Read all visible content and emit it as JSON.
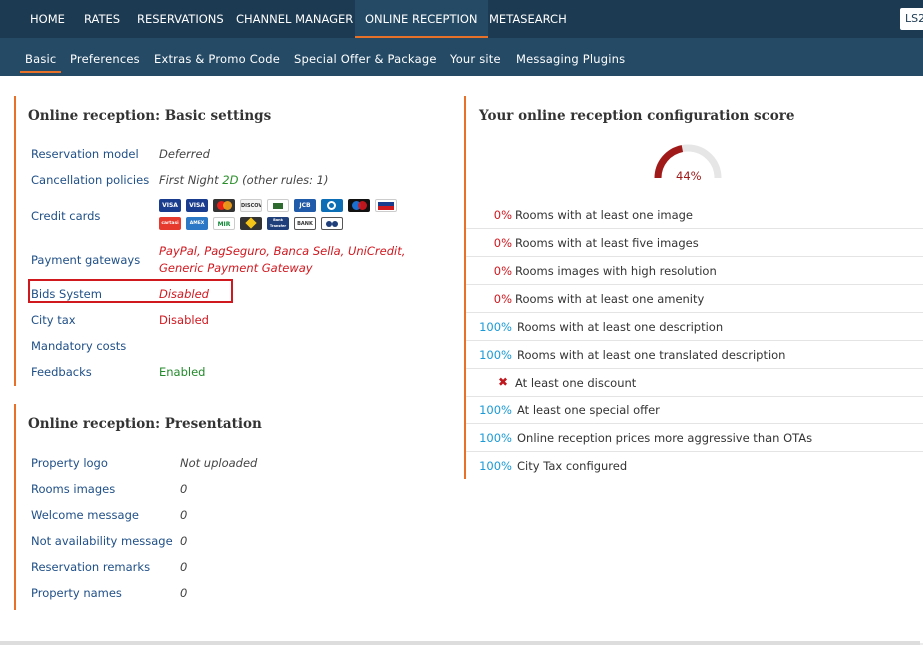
{
  "top_nav": {
    "items": [
      "HOME",
      "RATES",
      "RESERVATIONS",
      "CHANNEL MANAGER",
      "ONLINE RECEPTION",
      "METASEARCH"
    ],
    "active": "ONLINE RECEPTION",
    "account": "LS2"
  },
  "sub_nav": {
    "items": [
      "Basic",
      "Preferences",
      "Extras & Promo Code",
      "Special Offer & Package",
      "Your site",
      "Messaging Plugins"
    ],
    "active": "Basic"
  },
  "basic": {
    "title": "Online reception: Basic settings",
    "reservation_model": {
      "label": "Reservation model",
      "value": "Deferred"
    },
    "cancellation": {
      "label": "Cancellation policies",
      "value_prefix": "First Night",
      "value_highlight": "2D",
      "value_suffix": "(other rules: 1)"
    },
    "credit_cards": {
      "label": "Credit cards",
      "cards": [
        "VISA",
        "VISA",
        "MasterCard",
        "DISCOVER",
        "card",
        "JCB",
        "Diners",
        "Maestro",
        "PostePay",
        "cartasi",
        "AMEX",
        "MIR",
        "card",
        "Bank Transfer",
        "BANK",
        "card"
      ]
    },
    "payment_gateways": {
      "label": "Payment gateways",
      "value_line1": "PayPal, PagSeguro, Banca Sella, UniCredit,",
      "value_line2": "Generic Payment Gateway"
    },
    "bids_system": {
      "label": "Bids System",
      "value": "Disabled"
    },
    "city_tax": {
      "label": "City tax",
      "value": "Disabled"
    },
    "mandatory_costs": {
      "label": "Mandatory costs",
      "value": ""
    },
    "feedbacks": {
      "label": "Feedbacks",
      "value": "Enabled"
    }
  },
  "presentation": {
    "title": "Online reception: Presentation",
    "rows": [
      {
        "label": "Property logo",
        "value": "Not uploaded"
      },
      {
        "label": "Rooms images",
        "value": "0"
      },
      {
        "label": "Welcome message",
        "value": "0"
      },
      {
        "label": "Not availability message",
        "value": "0"
      },
      {
        "label": "Reservation remarks",
        "value": "0"
      },
      {
        "label": "Property names",
        "value": "0"
      }
    ]
  },
  "score": {
    "title": "Your online reception configuration score",
    "value_label": "44%",
    "value": 0.44,
    "colors": {
      "arc": "#a11a1a",
      "track": "#e6e6e6",
      "zero": "#d0181f",
      "full": "#1a9ad6"
    },
    "rows": [
      {
        "pct": "0%",
        "text": "Rooms with at least one image",
        "status": "zero"
      },
      {
        "pct": "0%",
        "text": "Rooms with at least five images",
        "status": "zero"
      },
      {
        "pct": "0%",
        "text": "Rooms images with high resolution",
        "status": "zero"
      },
      {
        "pct": "0%",
        "text": "Rooms with at least one amenity",
        "status": "zero"
      },
      {
        "pct": "100%",
        "text": "Rooms with at least one description",
        "status": "full"
      },
      {
        "pct": "100%",
        "text": "Rooms with at least one translated description",
        "status": "full"
      },
      {
        "pct": "",
        "text": "At least one discount",
        "status": "missing",
        "icon": "x-mark-icon"
      },
      {
        "pct": "100%",
        "text": "At least one special offer",
        "status": "full"
      },
      {
        "pct": "100%",
        "text": "Online reception prices more aggressive than OTAs",
        "status": "full"
      },
      {
        "pct": "100%",
        "text": "City Tax configured",
        "status": "full"
      }
    ]
  }
}
